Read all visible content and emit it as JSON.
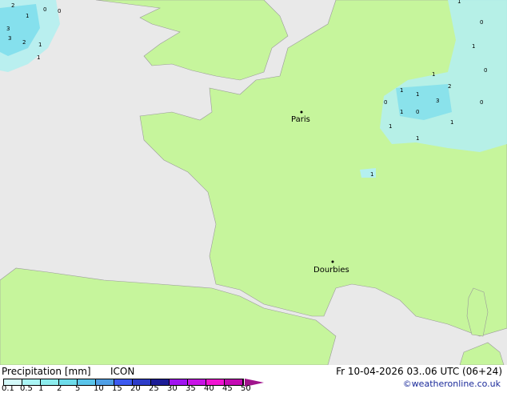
{
  "map": {
    "colors": {
      "sea": "#e9e9e9",
      "land": "#c6f59c",
      "border": "#9a9a9a",
      "rain_light": "#b4f0f0",
      "rain_mid": "#78dcec"
    },
    "cities": [
      {
        "name": "Paris"
      },
      {
        "name": "Dourbies"
      }
    ],
    "precip_labels": [
      "2",
      "1",
      "3",
      "3",
      "2",
      "1",
      "0",
      "0",
      "1",
      "1",
      "0",
      "1",
      "0",
      "1",
      "2",
      "1",
      "1",
      "3",
      "1",
      "0",
      "1",
      "1",
      "0",
      "1",
      "0",
      "1"
    ]
  },
  "footer": {
    "title": "Precipitation [mm]",
    "model": "ICON",
    "datetime": "Fr 10-04-2026 03..06 UTC (06+24)",
    "copyright": "©weatheronline.co.uk",
    "legend": {
      "colors": [
        "#d4fafa",
        "#aaf5f5",
        "#8ceced",
        "#6edcea",
        "#5ac4ea",
        "#4f9fe6",
        "#3c5af0",
        "#2d3cc8",
        "#1c1c96",
        "#a014f0",
        "#c814e6",
        "#f014d2",
        "#c40ab4"
      ],
      "labels": [
        "0.1",
        "0.5",
        "1",
        "2",
        "5",
        "10",
        "15",
        "20",
        "25",
        "30",
        "35",
        "40",
        "45",
        "50"
      ]
    }
  }
}
